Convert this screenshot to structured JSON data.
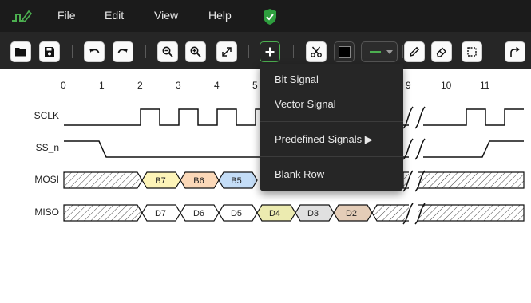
{
  "menubar": {
    "items": [
      "File",
      "Edit",
      "View",
      "Help"
    ]
  },
  "toolbar": {
    "buttons": [
      "open-folder-icon",
      "save-icon",
      "undo-icon",
      "redo-icon",
      "zoom-out-icon",
      "zoom-in-icon",
      "fit-icon",
      "add-icon",
      "cut-icon",
      "color-swatch",
      "stroke-style",
      "pen-icon",
      "eraser-icon",
      "select-icon",
      "curved-arrow-icon"
    ],
    "accent_color": "#4caf50",
    "swatch_color": "#000000"
  },
  "add_menu": {
    "items": [
      "Bit Signal",
      "Vector Signal",
      "Predefined Signals ▶",
      "Blank Row"
    ]
  },
  "timeline": {
    "ticks": [
      "0",
      "1",
      "2",
      "3",
      "4",
      "5",
      "9",
      "10",
      "11"
    ]
  },
  "signals": [
    {
      "name": "SCLK"
    },
    {
      "name": "SS_n"
    },
    {
      "name": "MOSI",
      "segments": [
        {
          "label": "B7",
          "color": "#fdf4b8"
        },
        {
          "label": "B6",
          "color": "#fbd8b8"
        },
        {
          "label": "B5",
          "color": "#c4ddf7"
        }
      ]
    },
    {
      "name": "MISO",
      "segments": [
        {
          "label": "D7",
          "color": "#ffffff"
        },
        {
          "label": "D6",
          "color": "#ffffff"
        },
        {
          "label": "D5",
          "color": "#ffffff"
        },
        {
          "label": "D4",
          "color": "#ecebb0"
        },
        {
          "label": "D3",
          "color": "#e0e0e0"
        },
        {
          "label": "D2",
          "color": "#e4cdb8"
        }
      ]
    }
  ]
}
